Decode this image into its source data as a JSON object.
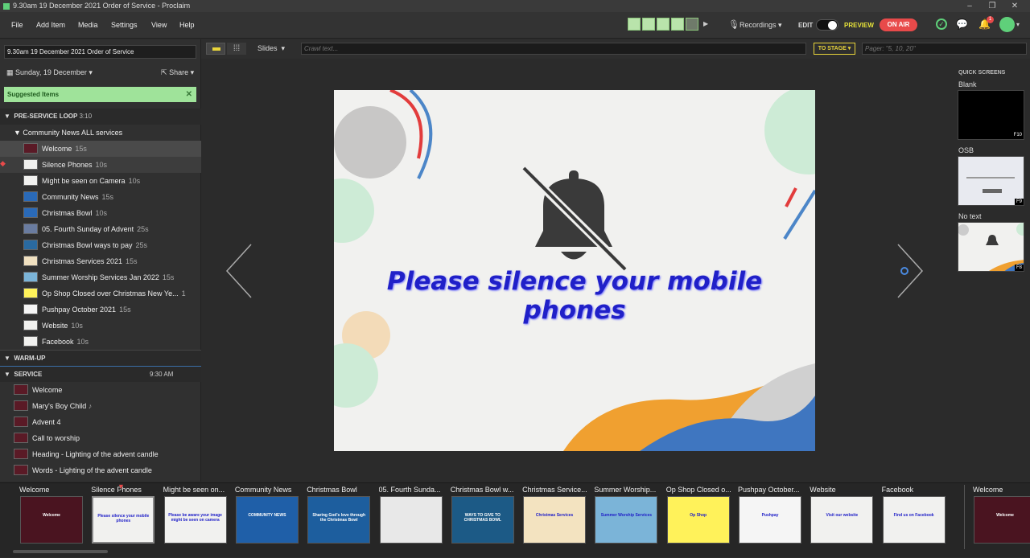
{
  "window": {
    "title": "9.30am 19 December 2021 Order of Service - Proclaim"
  },
  "menu": [
    "File",
    "Add Item",
    "Media",
    "Settings",
    "View",
    "Help"
  ],
  "toolbar": {
    "recordings_label": "Recordings",
    "edit_label": "EDIT",
    "preview_label": "PREVIEW",
    "on_air_label": "ON AIR",
    "notification_count": "1"
  },
  "subtoolbar": {
    "slides_label": "Slides",
    "crawl_placeholder": "Crawl text...",
    "to_stage_label": "TO STAGE",
    "pager_placeholder": "Pager: \"5, 10, 20\""
  },
  "left": {
    "service_name": "9.30am 19 December 2021 Order of Service",
    "date_label": "Sunday, 19 December",
    "share_label": "Share",
    "suggested_label": "Suggested Items",
    "sections": {
      "preservice": {
        "label": "PRE-SERVICE LOOP",
        "time": "3:10"
      },
      "group": "Community News ALL services",
      "warmup": {
        "label": "WARM-UP"
      },
      "service": {
        "label": "SERVICE",
        "time": "9:30 AM"
      }
    },
    "loop_items": [
      {
        "label": "Welcome",
        "dur": "15s"
      },
      {
        "label": "Silence Phones",
        "dur": "10s"
      },
      {
        "label": "Might be seen on Camera",
        "dur": "10s"
      },
      {
        "label": "Community News",
        "dur": "15s"
      },
      {
        "label": "Christmas Bowl",
        "dur": "10s"
      },
      {
        "label": "05. Fourth Sunday of Advent",
        "dur": "25s"
      },
      {
        "label": "Christmas Bowl ways to pay",
        "dur": "25s"
      },
      {
        "label": "Christmas Services 2021",
        "dur": "15s"
      },
      {
        "label": "Summer Worship Services Jan 2022",
        "dur": "15s"
      },
      {
        "label": "Op Shop Closed over Christmas New Ye...",
        "dur": "1"
      },
      {
        "label": "Pushpay October 2021",
        "dur": "15s"
      },
      {
        "label": "Website",
        "dur": "10s"
      },
      {
        "label": "Facebook",
        "dur": "10s"
      }
    ],
    "service_items": [
      {
        "label": "Welcome",
        "note": ""
      },
      {
        "label": "Mary's Boy Child",
        "note": "♪"
      },
      {
        "label": "Advent 4",
        "note": ""
      },
      {
        "label": "Call to worship",
        "note": ""
      },
      {
        "label": "Heading - Lighting of the advent candle",
        "note": ""
      },
      {
        "label": "Words - Lighting of the advent candle",
        "note": ""
      }
    ]
  },
  "slide": {
    "text": "Please silence your mobile phones"
  },
  "quick": {
    "header": "QUICK SCREENS",
    "items": [
      {
        "label": "Blank",
        "key": "F10"
      },
      {
        "label": "OSB",
        "key": "F9"
      },
      {
        "label": "No text",
        "key": "F8"
      }
    ]
  },
  "strip": [
    {
      "label": "Welcome",
      "thumb": "Welcome",
      "bg": "#4a1420"
    },
    {
      "label": "Silence Phones",
      "thumb": "Please silence your mobile phones",
      "bg": "#f1f1ef"
    },
    {
      "label": "Might be seen on...",
      "thumb": "Please be aware your image might be seen on camera",
      "bg": "#f1f1ef"
    },
    {
      "label": "Community News",
      "thumb": "COMMUNITY NEWS",
      "bg": "#1f5fa8"
    },
    {
      "label": "Christmas Bowl",
      "thumb": "Sharing God's love through the Christmas Bowl",
      "bg": "#1d5e9e"
    },
    {
      "label": "05. Fourth Sunda...",
      "thumb": "",
      "bg": "#e8e8e8"
    },
    {
      "label": "Christmas Bowl w...",
      "thumb": "WAYS TO GIVE TO CHRISTMAS BOWL",
      "bg": "#1c5a86"
    },
    {
      "label": "Christmas Service...",
      "thumb": "Christmas Services",
      "bg": "#f3e3c0"
    },
    {
      "label": "Summer Worship...",
      "thumb": "Summer Worship Services",
      "bg": "#7bb4d8"
    },
    {
      "label": "Op Shop Closed o...",
      "thumb": "Op Shop",
      "bg": "#fff25a"
    },
    {
      "label": "Pushpay October...",
      "thumb": "Pushpay",
      "bg": "#f5f5f5"
    },
    {
      "label": "Website",
      "thumb": "Visit our website",
      "bg": "#f1f1ef"
    },
    {
      "label": "Facebook",
      "thumb": "Find us on Facebook",
      "bg": "#f1f1ef"
    },
    {
      "label": "Welcome",
      "thumb": "Welcome",
      "bg": "#4a1420"
    }
  ],
  "colors": {
    "accent_green": "#5fd07a",
    "on_air": "#e84a4a",
    "preview_yellow": "#e8e43a",
    "selection": "#555555"
  }
}
